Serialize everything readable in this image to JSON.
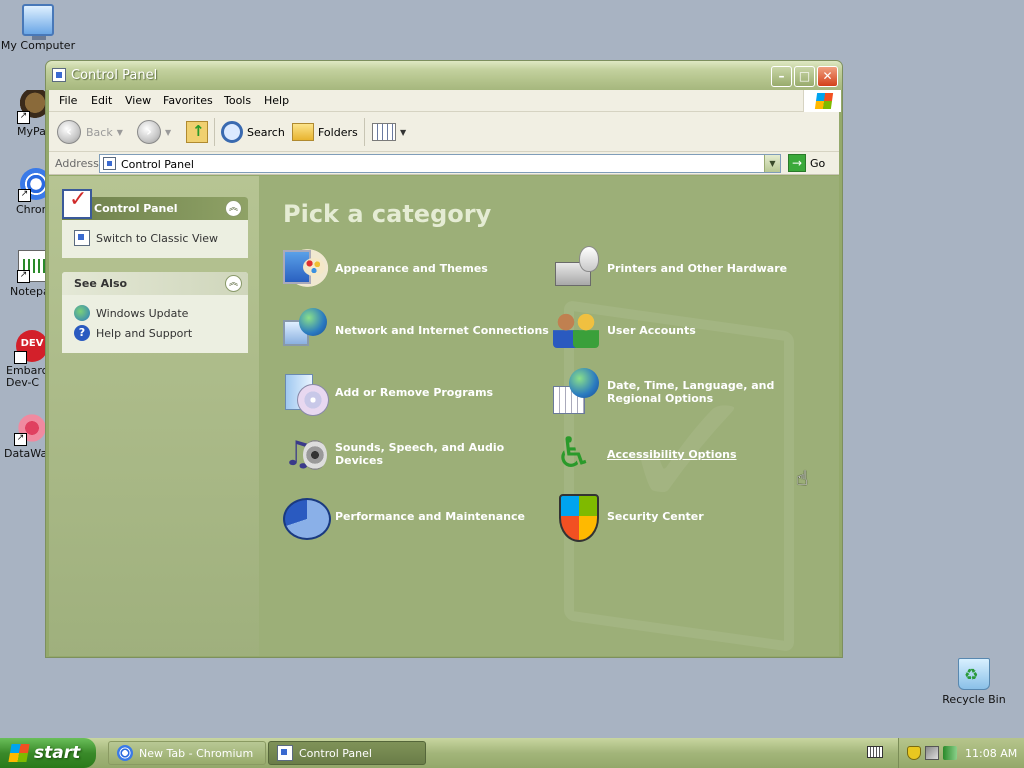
{
  "desktop": {
    "icons": [
      {
        "label": "My Computer"
      },
      {
        "label": "MyPal"
      },
      {
        "label": "Chrom"
      },
      {
        "label": "Notepa"
      },
      {
        "label": "Embarca\nDev-C"
      },
      {
        "label": "DataWag"
      },
      {
        "label": "Recycle Bin"
      }
    ]
  },
  "window": {
    "title": "Control Panel",
    "menu": [
      "File",
      "Edit",
      "View",
      "Favorites",
      "Tools",
      "Help"
    ],
    "toolbar": {
      "back_label": "Back",
      "search_label": "Search",
      "folders_label": "Folders"
    },
    "address": {
      "label": "Address",
      "value": "Control Panel",
      "go_label": "Go"
    },
    "sidebar": {
      "panel1": {
        "title": "Control Panel",
        "links": [
          "Switch to Classic View"
        ]
      },
      "panel2": {
        "title": "See Also",
        "links": [
          "Windows Update",
          "Help and Support"
        ]
      }
    },
    "main": {
      "heading": "Pick a category",
      "categories": [
        {
          "label": "Appearance and Themes",
          "icon": "appearance-themes-icon"
        },
        {
          "label": "Printers and Other Hardware",
          "icon": "printer-icon"
        },
        {
          "label": "Network and Internet Connections",
          "icon": "network-icon"
        },
        {
          "label": "User Accounts",
          "icon": "user-accounts-icon"
        },
        {
          "label": "Add or Remove Programs",
          "icon": "add-remove-programs-icon"
        },
        {
          "label": "Date, Time, Language, and Regional Options",
          "icon": "date-time-icon"
        },
        {
          "label": "Sounds, Speech, and Audio Devices",
          "icon": "sounds-icon"
        },
        {
          "label": "Accessibility Options",
          "icon": "accessibility-icon"
        },
        {
          "label": "Performance and Maintenance",
          "icon": "performance-icon"
        },
        {
          "label": "Security Center",
          "icon": "security-shield-icon"
        }
      ]
    }
  },
  "taskbar": {
    "start_label": "start",
    "tasks": [
      {
        "label": "New Tab - Chromium"
      },
      {
        "label": "Control Panel"
      }
    ],
    "clock": "11:08 AM"
  },
  "colors": {
    "content_bg": "#9caf78",
    "sidebar_header": "#6d7f4b",
    "taskbar": "#a3b57a",
    "start_button": "#3a8a2a"
  }
}
